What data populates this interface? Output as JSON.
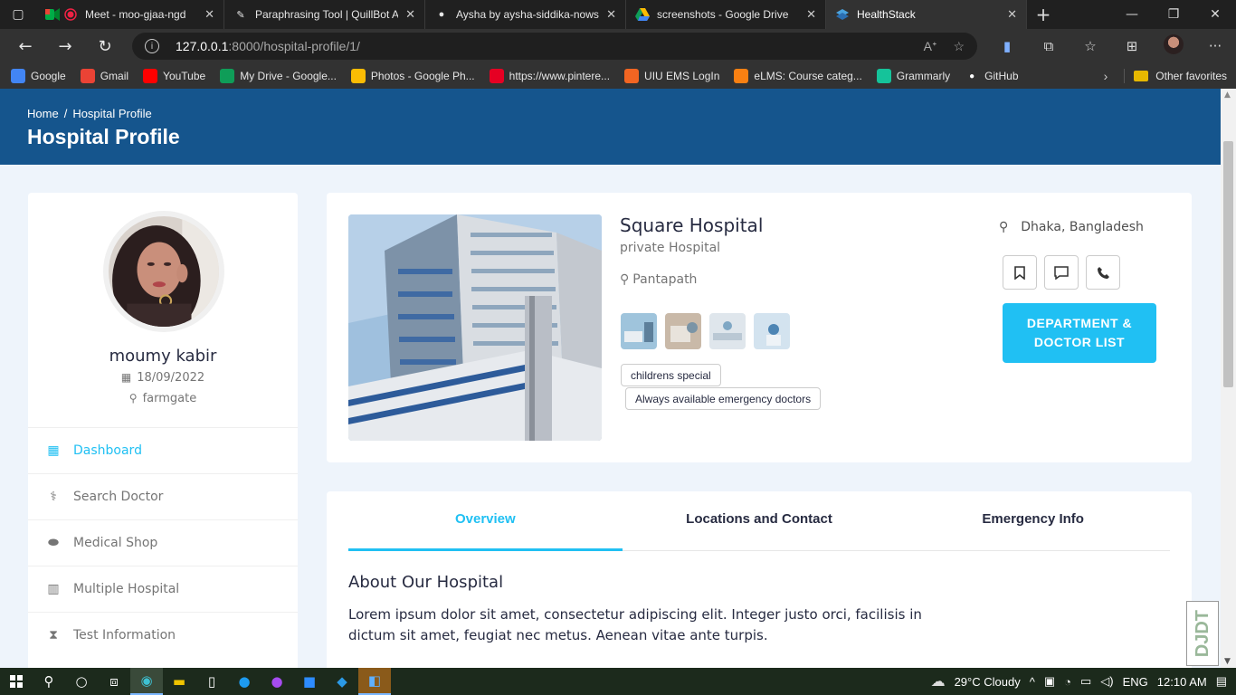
{
  "browser": {
    "tabs": [
      {
        "title": "Meet - moo-gjaa-ngd",
        "icon": "google-meet-icon"
      },
      {
        "title": "Paraphrasing Tool | QuillBot AI",
        "icon": "quillbot-icon"
      },
      {
        "title": "Aysha by aysha-siddika-nows",
        "icon": "github-icon"
      },
      {
        "title": "screenshots - Google Drive",
        "icon": "google-drive-icon"
      },
      {
        "title": "HealthStack",
        "icon": "healthstack-icon",
        "active": true
      }
    ],
    "url_host": "127.0.0.1",
    "url_path": ":8000/hospital-profile/1/",
    "bookmarks": [
      {
        "label": "Google",
        "icon": "google-icon",
        "color": "#4285f4"
      },
      {
        "label": "Gmail",
        "icon": "gmail-icon",
        "color": "#ea4335"
      },
      {
        "label": "YouTube",
        "icon": "youtube-icon",
        "color": "#ff0000"
      },
      {
        "label": "My Drive - Google...",
        "icon": "google-drive-icon",
        "color": "#0f9d58"
      },
      {
        "label": "Photos - Google Ph...",
        "icon": "google-photos-icon",
        "color": "#fbbc04"
      },
      {
        "label": "https://www.pintere...",
        "icon": "pinterest-icon",
        "color": "#e60023"
      },
      {
        "label": "UIU EMS LogIn",
        "icon": "uiu-icon",
        "color": "#f26522"
      },
      {
        "label": "eLMS: Course categ...",
        "icon": "moodle-icon",
        "color": "#f98012"
      },
      {
        "label": "Grammarly",
        "icon": "grammarly-icon",
        "color": "#15c39a"
      },
      {
        "label": "GitHub",
        "icon": "github-icon",
        "color": "#ffffff"
      }
    ],
    "other_favorites": "Other favorites"
  },
  "page": {
    "breadcrumb_home": "Home",
    "breadcrumb_sep": "/",
    "breadcrumb_current": "Hospital Profile",
    "title": "Hospital Profile"
  },
  "profile": {
    "name": "moumy kabir",
    "date": "18/09/2022",
    "location": "farmgate"
  },
  "side_menu": [
    {
      "label": "Dashboard",
      "icon": "dashboard-icon",
      "active": true
    },
    {
      "label": "Search Doctor",
      "icon": "doctor-icon"
    },
    {
      "label": "Medical Shop",
      "icon": "pills-icon"
    },
    {
      "label": "Multiple Hospital",
      "icon": "hospital-icon"
    },
    {
      "label": "Test Information",
      "icon": "hourglass-icon"
    }
  ],
  "hospital": {
    "name": "Square Hospital",
    "type": "private Hospital",
    "address": "Pantapath",
    "city": "Dhaka, Bangladesh",
    "tags": [
      "childrens special",
      "Always available emergency doctors"
    ],
    "dept_button": "DEPARTMENT & DOCTOR LIST"
  },
  "profile_tabs": [
    {
      "label": "Overview",
      "active": true
    },
    {
      "label": "Locations and Contact"
    },
    {
      "label": "Emergency Info"
    }
  ],
  "about": {
    "title": "About Our Hospital",
    "text": "Lorem ipsum dolor sit amet, consectetur adipiscing elit. Integer justo orci, facilisis in dictum sit amet, feugiat nec metus. Aenean vitae ante turpis."
  },
  "taskbar": {
    "weather": "29°C  Cloudy",
    "lang": "ENG",
    "time": "12:10 AM"
  },
  "colors": {
    "header": "#15558d",
    "accent": "#20c0f3"
  }
}
